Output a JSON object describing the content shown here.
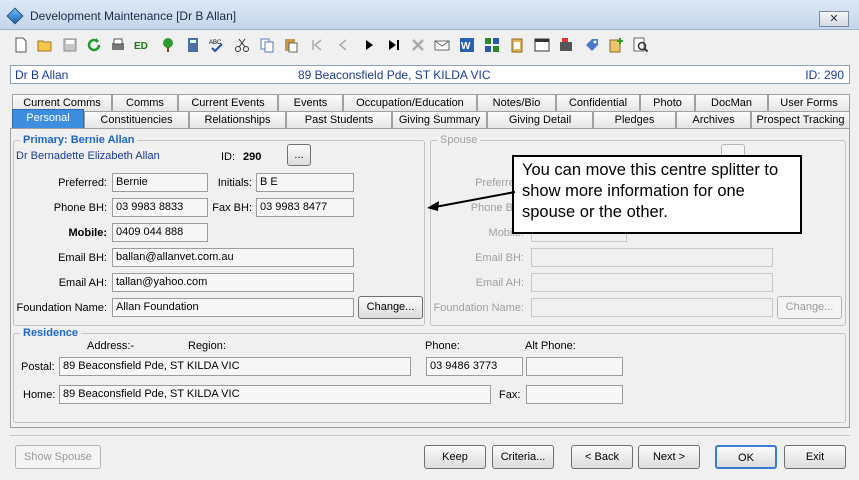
{
  "window": {
    "title": "Development Maintenance  [Dr B Allan]",
    "close_label": "✕"
  },
  "toolbar": {
    "icons": [
      "new-icon",
      "open-icon",
      "save-icon",
      "refresh-icon",
      "print-icon",
      "edit-icon",
      "tree-icon",
      "calculator-icon",
      "spellcheck-icon",
      "cut-icon",
      "copy-icon",
      "paste-icon",
      "first-icon",
      "prev-icon",
      "next-icon",
      "last-icon",
      "delete-icon",
      "mail-icon",
      "word-icon",
      "grid-icon",
      "clipboard-icon",
      "calendar-icon",
      "flag-icon",
      "tag-icon",
      "add-contact-icon",
      "preview-icon"
    ]
  },
  "infobar": {
    "name": "Dr B Allan",
    "address": "89 Beaconsfield Pde, ST KILDA VIC",
    "id": "ID: 290"
  },
  "tabs_row1": [
    "Current Comms",
    "Comms",
    "Current Events",
    "Events",
    "Occupation/Education",
    "Notes/Bio",
    "Confidential",
    "Photo",
    "DocMan",
    "User Forms"
  ],
  "tabs_row2": [
    "Personal",
    "Constituencies",
    "Relationships",
    "Past Students",
    "Giving Summary",
    "Giving Detail",
    "Pledges",
    "Archives",
    "Prospect Tracking"
  ],
  "primary": {
    "group_label": "Primary: Bernie Allan",
    "full_name": "Dr Bernadette Elizabeth Allan",
    "id_label": "ID:",
    "id_value": "290",
    "lookup_label": "...",
    "preferred_label": "Preferred:",
    "preferred": "Bernie",
    "initials_label": "Initials:",
    "initials": "B E",
    "phone_bh_label": "Phone BH:",
    "phone_bh": "03 9983 8833",
    "fax_bh_label": "Fax BH:",
    "fax_bh": "03 9983 8477",
    "mobile_label": "Mobile:",
    "mobile": "0409 044 888",
    "email_bh_label": "Email BH:",
    "email_bh": "ballan@allanvet.com.au",
    "email_ah_label": "Email AH:",
    "email_ah": "tallan@yahoo.com",
    "foundation_label": "Foundation Name:",
    "foundation": "Allan Foundation",
    "change_label": "Change..."
  },
  "spouse": {
    "group_label": "Spouse",
    "preferred_label": "Preferred:",
    "phone_label": "Phone BH:",
    "mobile_label": "Mobile:",
    "email_bh_label": "Email BH:",
    "email_ah_label": "Email AH:",
    "foundation_label": "Foundation Name:",
    "change_label": "Change..."
  },
  "callout": {
    "text": "You can move this centre splitter to show more information for one spouse or the other."
  },
  "residence": {
    "group_label": "Residence",
    "address_label": "Address:-",
    "region_label": "Region:",
    "phone_label": "Phone:",
    "alt_phone_label": "Alt Phone:",
    "postal_label": "Postal:",
    "postal": "89 Beaconsfield Pde, ST KILDA VIC",
    "phone": "03 9486 3773",
    "alt_phone": "",
    "home_label": "Home:",
    "home": "89 Beaconsfield Pde, ST KILDA VIC",
    "fax_label": "Fax:",
    "fax": ""
  },
  "footer": {
    "show_spouse": "Show Spouse",
    "keep": "Keep",
    "criteria": "Criteria...",
    "back": "< Back",
    "next": "Next >",
    "ok": "OK",
    "exit": "Exit"
  }
}
